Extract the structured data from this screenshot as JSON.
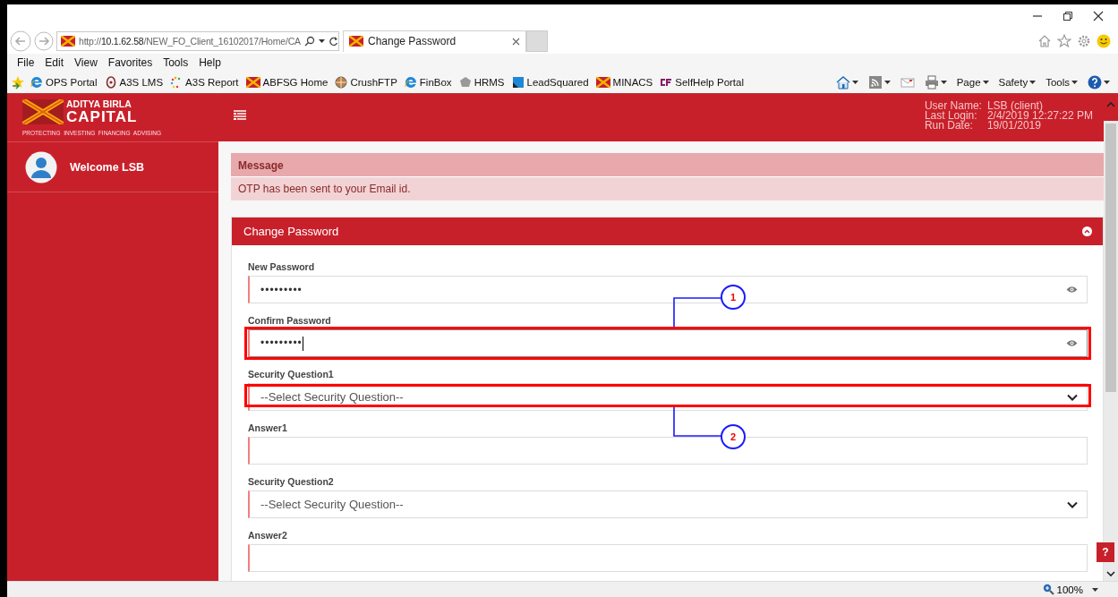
{
  "browser": {
    "address": "http://**10.1.62.58**/NEW_FO_Client_16102017/Home/CA",
    "tab": {
      "title": "Change Password",
      "selected": true
    },
    "menu": [
      "File",
      "Edit",
      "View",
      "Favorites",
      "Tools",
      "Help"
    ],
    "favorites": [
      {
        "label": "OPS Portal",
        "kind": "ie"
      },
      {
        "label": "A3S LMS",
        "kind": "ring"
      },
      {
        "label": "A3S Report",
        "kind": "dots"
      },
      {
        "label": "ABFSG Home",
        "kind": "logo"
      },
      {
        "label": "CrushFTP",
        "kind": "globe"
      },
      {
        "label": "FinBox",
        "kind": "ie"
      },
      {
        "label": "HRMS",
        "kind": "hex"
      },
      {
        "label": "LeadSquared",
        "kind": "square"
      },
      {
        "label": "MINACS",
        "kind": "logo"
      },
      {
        "label": "SelfHelp Portal",
        "kind": "cf"
      }
    ],
    "command_menus": [
      "Page",
      "Safety",
      "Tools"
    ],
    "zoom": "100%"
  },
  "app": {
    "logo": {
      "line1": "ADITYA BIRLA",
      "line2": "CAPITAL",
      "tagline": "PROTECTING  INVESTING  FINANCING  ADVISING"
    },
    "user_info": [
      {
        "label": "User Name:",
        "value": "LSB (client)"
      },
      {
        "label": "Last Login:",
        "value": "2/4/2019 12:27:22 PM"
      },
      {
        "label": "Run Date:",
        "value": "19/01/2019"
      }
    ],
    "welcome": "Welcome LSB"
  },
  "message": {
    "title": "Message",
    "text": "OTP has been sent to your Email id."
  },
  "panel": {
    "title": "Change Password",
    "fields": [
      {
        "label": "New Password",
        "kind": "password",
        "value": "•••••••••",
        "focused": false,
        "highlighted": false
      },
      {
        "label": "Confirm Password",
        "kind": "password",
        "value": "•••••••••",
        "focused": true,
        "highlighted": true,
        "callout": {
          "number": "1",
          "kind": "up"
        }
      },
      {
        "label": "Security Question1",
        "kind": "select",
        "value": "--Select Security Question--",
        "focused": false,
        "highlighted": true,
        "callout": {
          "number": "2",
          "kind": "down"
        }
      },
      {
        "label": "Answer1",
        "kind": "text",
        "focused": false,
        "highlighted": false
      },
      {
        "label": "Security Question2",
        "kind": "select",
        "value": "--Select Security Question--",
        "focused": false,
        "highlighted": false
      },
      {
        "label": "Answer2",
        "kind": "text",
        "focused": false,
        "highlighted": false
      }
    ]
  },
  "help_button": "?"
}
